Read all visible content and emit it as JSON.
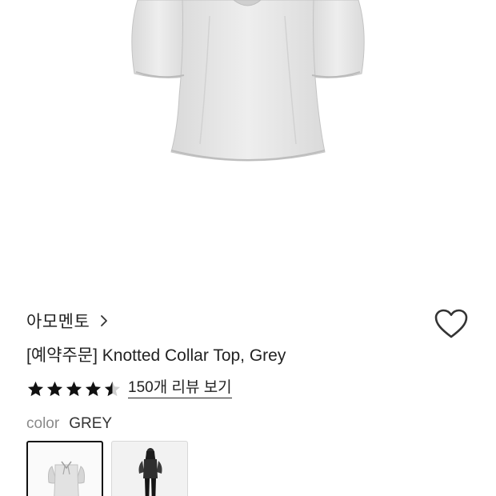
{
  "product": {
    "brand": "아모멘토",
    "title": "[예약주문] Knotted Collar Top, Grey",
    "rating": 4.5,
    "review_link": "150개 리뷰 보기"
  },
  "color": {
    "label": "color",
    "value": "GREY"
  },
  "icons": {
    "brand_chevron": "chevron-right-icon",
    "wishlist": "heart-outline-icon",
    "star": "star-icon"
  },
  "colors": {
    "star_fill": "#111111",
    "star_empty": "#d0d0d0",
    "text": "#222222",
    "muted": "#8a8a8a"
  }
}
